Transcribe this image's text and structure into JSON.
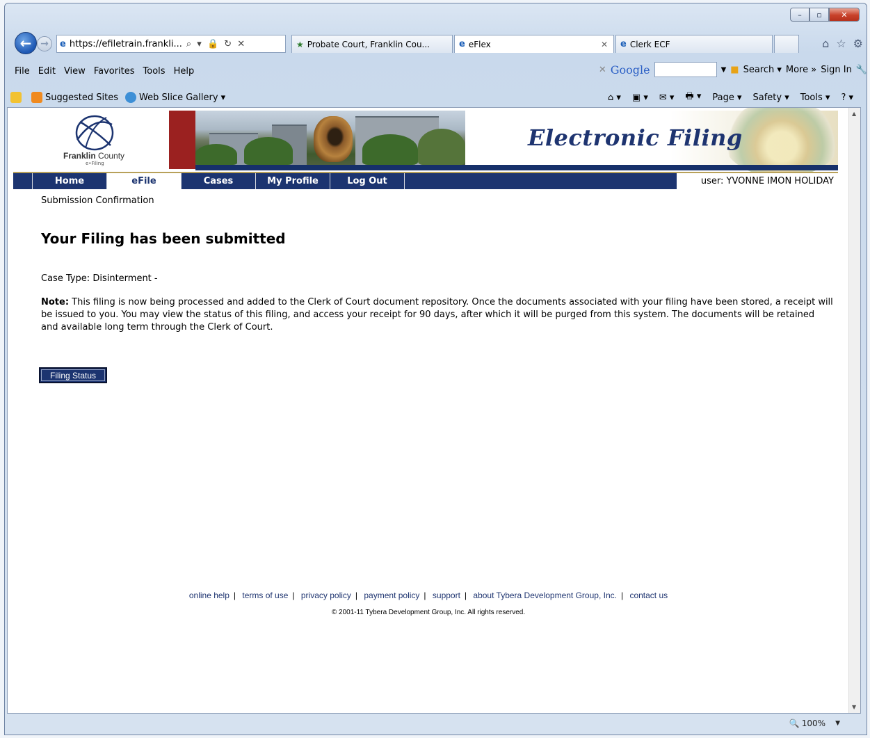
{
  "browser": {
    "window_controls": {
      "minimize": "–",
      "maximize": "▫",
      "close": "✕"
    },
    "address": "https://efiletrain.frankli...",
    "address_actions": "⌕ ▾ 🔒 ↻ ✕",
    "tabs": [
      {
        "label": "Probate Court, Franklin Cou...",
        "icon": "bookmark-star-icon"
      },
      {
        "label": "eFlex",
        "icon": "ie-icon",
        "close": "✕"
      },
      {
        "label": "Clerk ECF",
        "icon": "ie-icon"
      }
    ],
    "right_icons": {
      "home": "⌂",
      "favorites": "☆",
      "settings": "⚙"
    },
    "menu": [
      "File",
      "Edit",
      "View",
      "Favorites",
      "Tools",
      "Help"
    ],
    "google": {
      "close": "✕",
      "logo": "Google",
      "search": "Search ▾",
      "more": "More »",
      "sign_in": "Sign In"
    },
    "favorites_bar": [
      {
        "label": "Suggested Sites",
        "icon": "suggested-sites-icon"
      },
      {
        "label": "Web Slice Gallery ▾",
        "icon": "web-slice-icon"
      }
    ],
    "command_bar": [
      "⌂ ▾",
      "▣ ▾",
      "✉ ▾",
      "🖶 ▾",
      "Page ▾",
      "Safety ▾",
      "Tools ▾",
      "? ▾"
    ],
    "zoom": "100%"
  },
  "site": {
    "title": "Electronic Filing",
    "logo_county": "Franklin",
    "logo_county_suffix": "County",
    "logo_sub": "e•Filing",
    "nav": [
      "Home",
      "eFile",
      "Cases",
      "My Profile",
      "Log Out"
    ],
    "active_nav_index": 1,
    "user_label": "user: YVONNE IMON HOLIDAY"
  },
  "content": {
    "breadcrumb": "Submission Confirmation",
    "heading": "Your Filing has been submitted",
    "case_type": "Case Type: Disinterment -",
    "note_label": "Note:",
    "note_text": "This filing is now being processed and added to the Clerk of Court document repository. Once the documents associated with your filing have been stored, a receipt will be issued to you. You may view the status of this filing, and access your receipt for 90 days, after which it will be purged from this system. The documents will be retained and available long term through the Clerk of Court.",
    "filing_status_button": "Filing Status"
  },
  "footer": {
    "links": [
      "online help",
      "terms of use",
      "privacy policy",
      "payment policy",
      "support",
      "about Tybera Development Group, Inc.",
      "contact us"
    ],
    "copyright": "© 2001-11 Tybera Development Group, Inc. All rights reserved."
  },
  "colors": {
    "nav_bg": "#1c3470",
    "accent_red": "#9b2120",
    "title_blue": "#1e3470"
  }
}
